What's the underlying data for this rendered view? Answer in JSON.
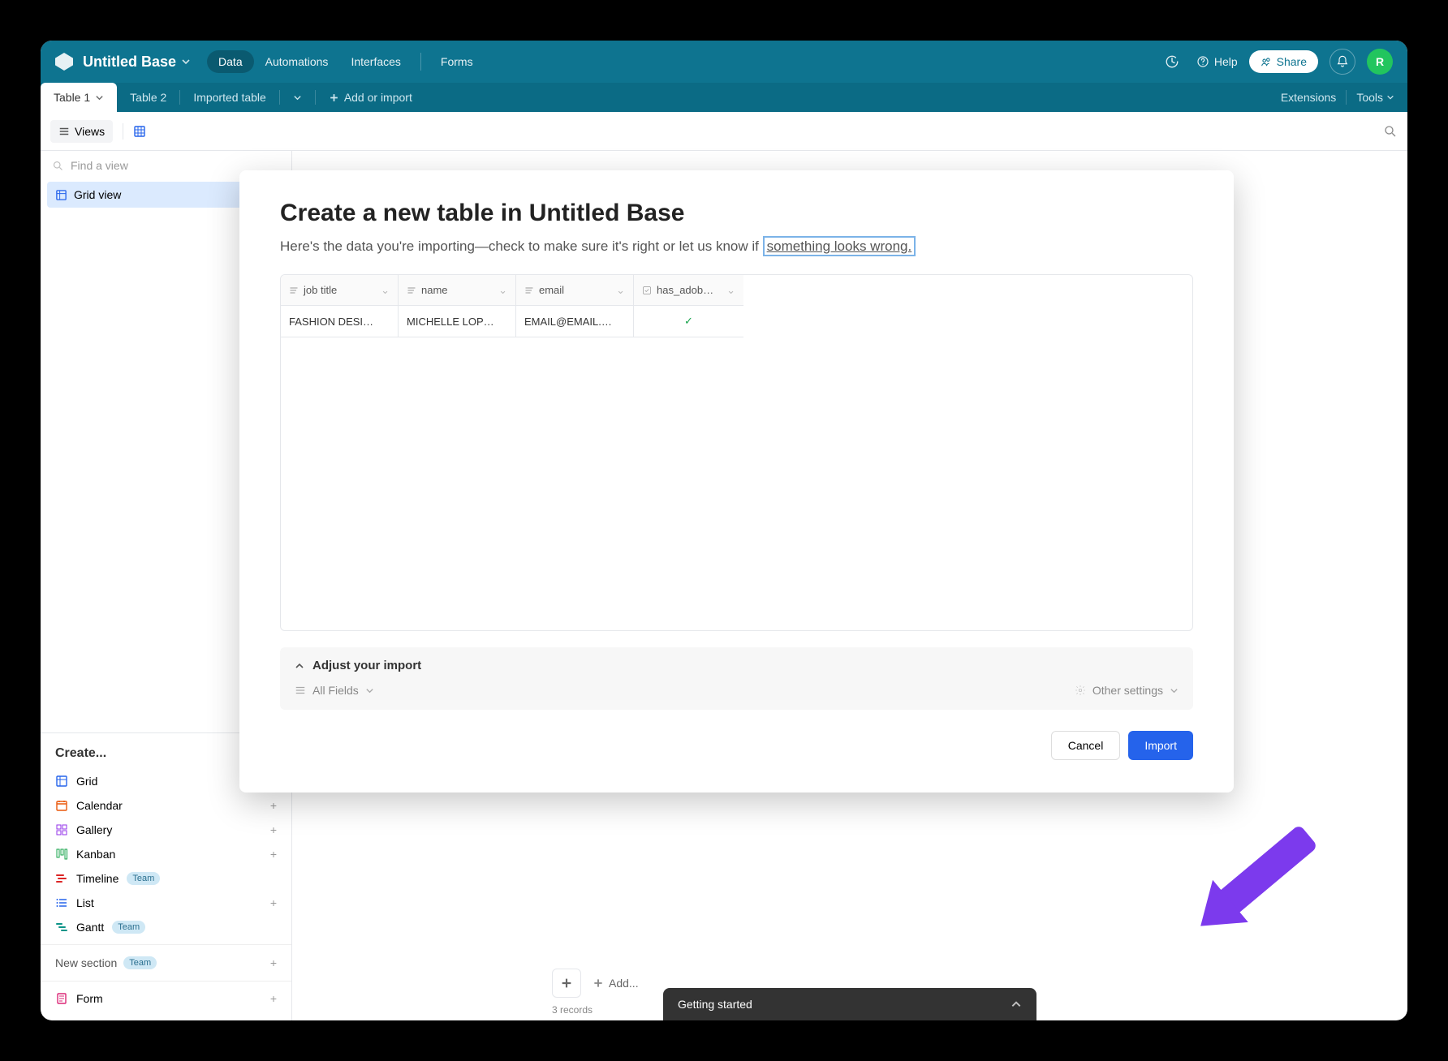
{
  "topbar": {
    "base_name": "Untitled Base",
    "nav": {
      "data": "Data",
      "automations": "Automations",
      "interfaces": "Interfaces",
      "forms": "Forms"
    },
    "help": "Help",
    "share": "Share",
    "avatar_initial": "R"
  },
  "tabs": {
    "table1": "Table 1",
    "table2": "Table 2",
    "imported": "Imported table",
    "add": "Add or import",
    "extensions": "Extensions",
    "tools": "Tools"
  },
  "toolbar": {
    "views": "Views"
  },
  "sidebar": {
    "find_placeholder": "Find a view",
    "grid_view": "Grid view",
    "create_header": "Create...",
    "items": {
      "grid": "Grid",
      "calendar": "Calendar",
      "gallery": "Gallery",
      "kanban": "Kanban",
      "timeline": "Timeline",
      "list": "List",
      "gantt": "Gantt",
      "form": "Form"
    },
    "team_badge": "Team",
    "new_section": "New section"
  },
  "bottom": {
    "add": "Add...",
    "records": "3 records"
  },
  "getting_started": "Getting started",
  "modal": {
    "title": "Create a new table in Untitled Base",
    "subtitle_prefix": "Here's the data you're importing—check to make sure it's right or let us know if ",
    "wrong_link": "something looks wrong.",
    "columns": {
      "job_title": "job title",
      "name": "name",
      "email": "email",
      "has_adobe": "has_adob…"
    },
    "row": {
      "job_title": "FASHION DESI…",
      "name": "MICHELLE LOP…",
      "email": "EMAIL@EMAIL.…"
    },
    "adjust": "Adjust your import",
    "all_fields": "All Fields",
    "other_settings": "Other settings",
    "cancel": "Cancel",
    "import": "Import"
  }
}
